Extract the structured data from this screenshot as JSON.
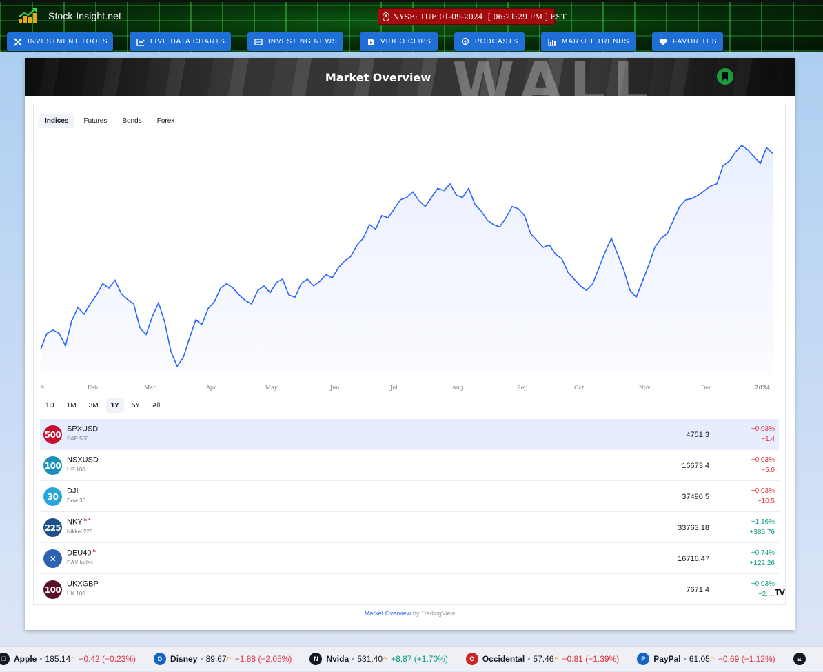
{
  "header": {
    "site_name": "Stock-Insight.net",
    "clock": "NYSE: TUE 01-09-2024  [ 06:21:29 PM ] EST",
    "nav": [
      {
        "label": "INVESTMENT TOOLS",
        "icon": "tools-icon"
      },
      {
        "label": "LIVE DATA CHARTS",
        "icon": "line-chart-icon"
      },
      {
        "label": "INVESTING NEWS",
        "icon": "newspaper-icon"
      },
      {
        "label": "VIDEO CLIPS",
        "icon": "video-file-icon"
      },
      {
        "label": "PODCASTS",
        "icon": "podcast-icon"
      },
      {
        "label": "MARKET TRENDS",
        "icon": "bar-chart-icon"
      },
      {
        "label": "FAVORITES",
        "icon": "heart-icon"
      }
    ]
  },
  "card": {
    "title": "Market Overview",
    "banner_text": "WALL"
  },
  "widget": {
    "tabs": [
      "Indices",
      "Futures",
      "Bonds",
      "Forex"
    ],
    "active_tab": "Indices",
    "ranges": [
      "1D",
      "1M",
      "3M",
      "1Y",
      "5Y",
      "All"
    ],
    "active_range": "1Y",
    "attribution_link": "Market Overview",
    "attribution_rest": " by TradingView",
    "rows": [
      {
        "badge": "500",
        "badge_color": "#c8102e",
        "symbol": "SPXUSD",
        "flag": "",
        "desc": "S&P 500",
        "price": "4751.3",
        "pct": "−0.03%",
        "chg": "−1.4",
        "dir": "neg"
      },
      {
        "badge": "100",
        "badge_color": "#1a8fb8",
        "symbol": "NSXUSD",
        "flag": "",
        "desc": "US 100",
        "price": "16673.4",
        "pct": "−0.03%",
        "chg": "−5.0",
        "dir": "neg"
      },
      {
        "badge": "30",
        "badge_color": "#2aa6d8",
        "symbol": "DJI",
        "flag": "",
        "desc": "Dow 30",
        "price": "37490.5",
        "pct": "−0.03%",
        "chg": "−10.5",
        "dir": "neg"
      },
      {
        "badge": "225",
        "badge_color": "#1e4f8a",
        "symbol": "NKY",
        "flag": "E •",
        "desc": "Nikkei 225",
        "price": "33763.18",
        "pct": "+1.16%",
        "chg": "+385.76",
        "dir": "pos"
      },
      {
        "badge": "✕",
        "badge_color": "#2d62b3",
        "symbol": "DEU40",
        "flag": "E",
        "desc": "DAX Index",
        "price": "16716.47",
        "pct": "+0.74%",
        "chg": "+122.26",
        "dir": "pos"
      },
      {
        "badge": "100",
        "badge_color": "#5a0f2a",
        "symbol": "UKXGBP",
        "flag": "",
        "desc": "UK 100",
        "price": "7671.4",
        "pct": "+0.03%",
        "chg": "+2.…",
        "dir": "pos"
      }
    ]
  },
  "chart_data": {
    "type": "area",
    "title": "",
    "series": [
      {
        "name": "",
        "color": "#2962ff"
      }
    ],
    "x_ticks": [
      "9",
      "Feb",
      "Mar",
      "Apr",
      "May",
      "Jun",
      "Jul",
      "Aug",
      "Sep",
      "Oct",
      "Nov",
      "Dec",
      "2024"
    ],
    "values": [
      3890,
      3960,
      3975,
      3960,
      3905,
      4015,
      4075,
      4045,
      4090,
      4130,
      4180,
      4160,
      4195,
      4135,
      4110,
      4090,
      3985,
      3955,
      4035,
      4095,
      4010,
      3880,
      3815,
      3855,
      3940,
      4020,
      4000,
      4070,
      4100,
      4160,
      4180,
      4160,
      4130,
      4105,
      4090,
      4150,
      4170,
      4140,
      4185,
      4200,
      4130,
      4120,
      4180,
      4200,
      4170,
      4190,
      4220,
      4205,
      4250,
      4280,
      4300,
      4350,
      4380,
      4440,
      4420,
      4480,
      4470,
      4510,
      4550,
      4560,
      4585,
      4545,
      4520,
      4560,
      4600,
      4590,
      4620,
      4570,
      4560,
      4600,
      4530,
      4500,
      4460,
      4440,
      4430,
      4470,
      4520,
      4510,
      4480,
      4400,
      4370,
      4340,
      4350,
      4310,
      4290,
      4230,
      4200,
      4170,
      4150,
      4180,
      4250,
      4320,
      4380,
      4310,
      4240,
      4150,
      4120,
      4190,
      4260,
      4340,
      4380,
      4400,
      4460,
      4520,
      4550,
      4555,
      4570,
      4590,
      4610,
      4620,
      4700,
      4720,
      4760,
      4790,
      4770,
      4740,
      4710,
      4780,
      4755
    ]
  },
  "ticker": [
    {
      "logo": "",
      "logo_color": "#131722",
      "name": "Apple",
      "price": "185.14",
      "flag": "D",
      "change": "−0.42 (−0.23%)",
      "dir": "neg"
    },
    {
      "logo": "D",
      "logo_color": "#1565c0",
      "name": "Disney",
      "price": "89.67",
      "flag": "D",
      "change": "−1.88 (−2.05%)",
      "dir": "neg"
    },
    {
      "logo": "N",
      "logo_color": "#131722",
      "name": "Nvida",
      "price": "531.40",
      "flag": "D",
      "change": "+8.87 (+1.70%)",
      "dir": "pos"
    },
    {
      "logo": "O",
      "logo_color": "#c62828",
      "name": "Occidental",
      "price": "57.46",
      "flag": "D",
      "change": "−0.81 (−1.39%)",
      "dir": "neg"
    },
    {
      "logo": "P",
      "logo_color": "#1565c0",
      "name": "PayPal",
      "price": "61.05",
      "flag": "D",
      "change": "−0.69 (−1.12%)",
      "dir": "neg"
    },
    {
      "logo": "a",
      "logo_color": "#131722",
      "name": "",
      "price": "",
      "flag": "",
      "change": "",
      "dir": "neg"
    }
  ]
}
